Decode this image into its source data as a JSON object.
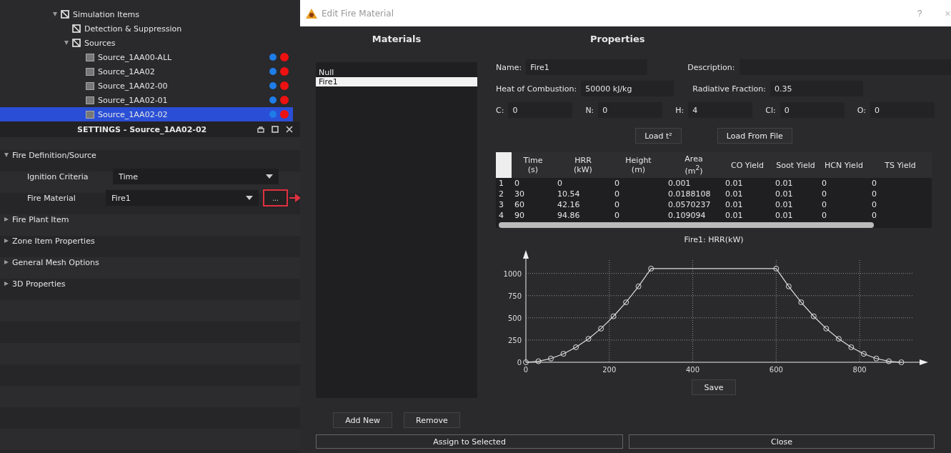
{
  "tree": [
    {
      "label": "Simulation Items",
      "expanded": true,
      "children": [
        {
          "label": "Detection & Suppression"
        },
        {
          "label": "Sources",
          "expanded": true,
          "children": [
            {
              "label": "Source_1AA00-ALL",
              "kind": "source",
              "selected": false
            },
            {
              "label": "Source_1AA02",
              "kind": "source",
              "selected": false
            },
            {
              "label": "Source_1AA02-00",
              "kind": "source",
              "selected": false
            },
            {
              "label": "Source_1AA02-01",
              "kind": "source",
              "selected": false
            },
            {
              "label": "Source_1AA02-02",
              "kind": "source",
              "selected": true
            }
          ]
        }
      ]
    }
  ],
  "settings": {
    "title": "SETTINGS - Source_1AA02-02",
    "sections": [
      {
        "label": "Fire Definition/Source",
        "expanded": true,
        "fields": [
          {
            "label": "Ignition Criteria",
            "value": "Time"
          },
          {
            "label": "Fire Material",
            "value": "Fire1",
            "button": "..."
          }
        ]
      },
      {
        "label": "Fire Plant Item",
        "expanded": false
      },
      {
        "label": "Zone Item Properties",
        "expanded": false
      },
      {
        "label": "General Mesh Options",
        "expanded": false
      },
      {
        "label": "3D Properties",
        "expanded": false
      }
    ]
  },
  "dialog": {
    "title": "Edit Fire Material",
    "help": "?",
    "close": "×",
    "materials": {
      "heading": "Materials",
      "items": [
        {
          "label": "Null",
          "selected": false
        },
        {
          "label": "Fire1",
          "selected": true
        }
      ],
      "buttons": [
        "Add New",
        "Remove"
      ]
    },
    "properties": {
      "heading": "Properties",
      "name": {
        "label": "Name:",
        "value": "Fire1"
      },
      "description": {
        "label": "Description:"
      },
      "heat": {
        "label": "Heat of Combustion:",
        "value": "50000 kJ/kg"
      },
      "radiative": {
        "label": "Radiative Fraction:",
        "value": "0.35"
      },
      "elements": [
        {
          "label": "C:",
          "value": "0"
        },
        {
          "label": "N:",
          "value": "0"
        },
        {
          "label": "H:",
          "value": "4"
        },
        {
          "label": "Cl:",
          "value": "0"
        },
        {
          "label": "O:",
          "value": "0"
        }
      ],
      "load_buttons": [
        "Load t²",
        "Load From File"
      ],
      "table": {
        "columns": [
          {
            "label": "Time",
            "unit": "(s)"
          },
          {
            "label": "HRR",
            "unit": "(kW)"
          },
          {
            "label": "Height",
            "unit": "(m)"
          },
          {
            "label": "Area",
            "unit": "(m$^{2}$)"
          },
          {
            "label": "CO Yield"
          },
          {
            "label": "Soot Yield"
          },
          {
            "label": "HCN Yield"
          },
          {
            "label": "TS Yield"
          }
        ],
        "rows": [
          {
            "index": "1",
            "cells": [
              "0",
              "0",
              "0",
              "0.001",
              "0.01",
              "0.01",
              "0",
              "0"
            ]
          },
          {
            "index": "2",
            "cells": [
              "30",
              "10.54",
              "0",
              "0.0188108",
              "0.01",
              "0.01",
              "0",
              "0"
            ]
          },
          {
            "index": "3",
            "cells": [
              "60",
              "42.16",
              "0",
              "0.0570237",
              "0.01",
              "0.01",
              "0",
              "0"
            ]
          },
          {
            "index": "4",
            "cells": [
              "90",
              "94.86",
              "0",
              "0.109094",
              "0.01",
              "0.01",
              "0",
              "0"
            ]
          }
        ]
      },
      "chart_data": {
        "type": "line",
        "title": "Fire1: HRR(kW)",
        "x": [
          0,
          30,
          60,
          90,
          120,
          150,
          180,
          210,
          240,
          270,
          300,
          600,
          630,
          660,
          690,
          720,
          750,
          780,
          810,
          840,
          870,
          900
        ],
        "series": [
          {
            "color": "#e0e0e0",
            "marker": "circle",
            "values": [
              0,
              11,
              42,
              95,
              169,
              264,
              379,
              517,
              675,
              854,
              1054,
              1054,
              854,
              675,
              517,
              379,
              264,
              169,
              95,
              42,
              11,
              0
            ]
          }
        ],
        "grid": true,
        "xlim": [
          0,
          930
        ],
        "ylim": [
          0,
          1150
        ],
        "xticks": [
          0,
          200,
          400,
          600,
          800
        ],
        "yticks": [
          0,
          250,
          500,
          750,
          1000
        ]
      },
      "save": "Save"
    },
    "footer": [
      "Assign to Selected",
      "Close"
    ]
  }
}
